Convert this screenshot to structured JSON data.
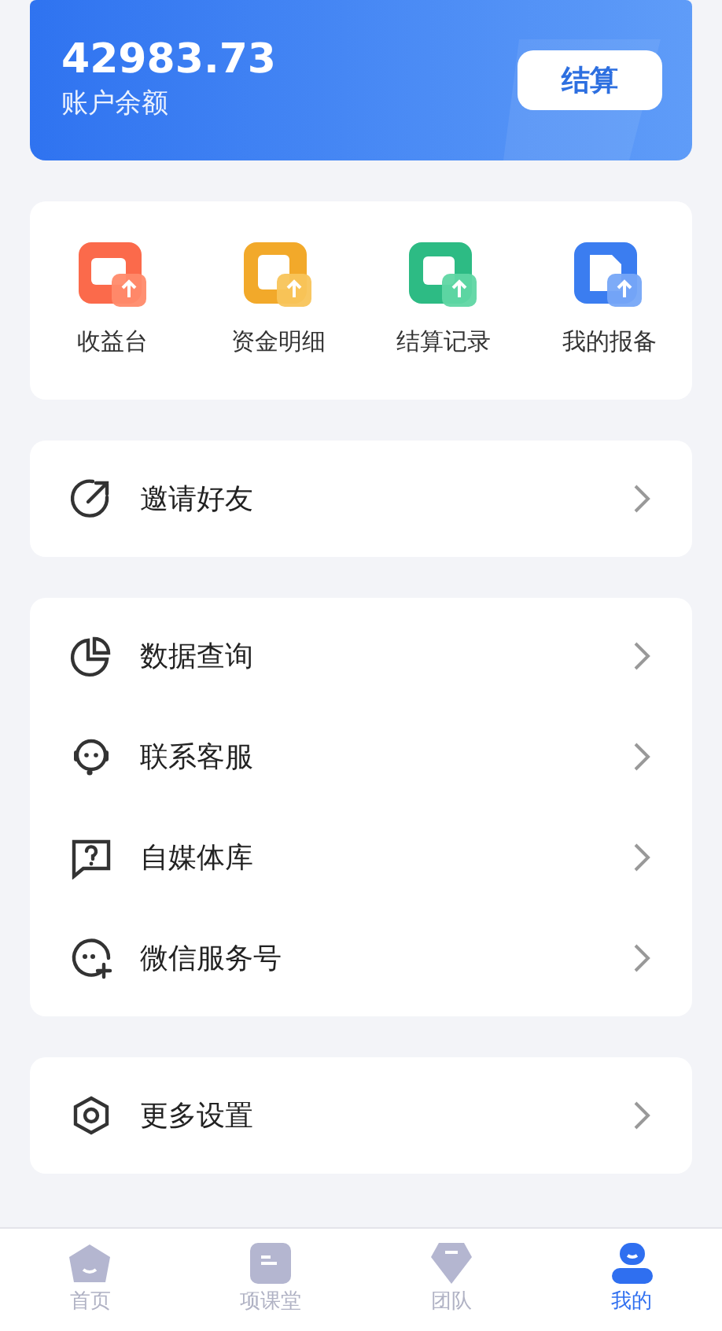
{
  "balance": {
    "amount": "42983.73",
    "label": "账户余额",
    "button": "结算"
  },
  "shortcuts": [
    {
      "kind": "wallet",
      "label": "收益台"
    },
    {
      "kind": "funds",
      "label": "资金明细"
    },
    {
      "kind": "settle",
      "label": "结算记录"
    },
    {
      "kind": "report",
      "label": "我的报备"
    }
  ],
  "menu_groups": [
    [
      {
        "kind": "share",
        "label": "邀请好友"
      }
    ],
    [
      {
        "kind": "chart",
        "label": "数据查询"
      },
      {
        "kind": "headset",
        "label": "联系客服"
      },
      {
        "kind": "question",
        "label": "自媒体库"
      },
      {
        "kind": "chat-add",
        "label": "微信服务号"
      }
    ],
    [
      {
        "kind": "settings",
        "label": "更多设置"
      }
    ]
  ],
  "tabs": [
    {
      "kind": "home",
      "label": "首页",
      "selected": false
    },
    {
      "kind": "class",
      "label": "项课堂",
      "selected": false
    },
    {
      "kind": "team",
      "label": "团队",
      "selected": false
    },
    {
      "kind": "me",
      "label": "我的",
      "selected": true
    }
  ]
}
